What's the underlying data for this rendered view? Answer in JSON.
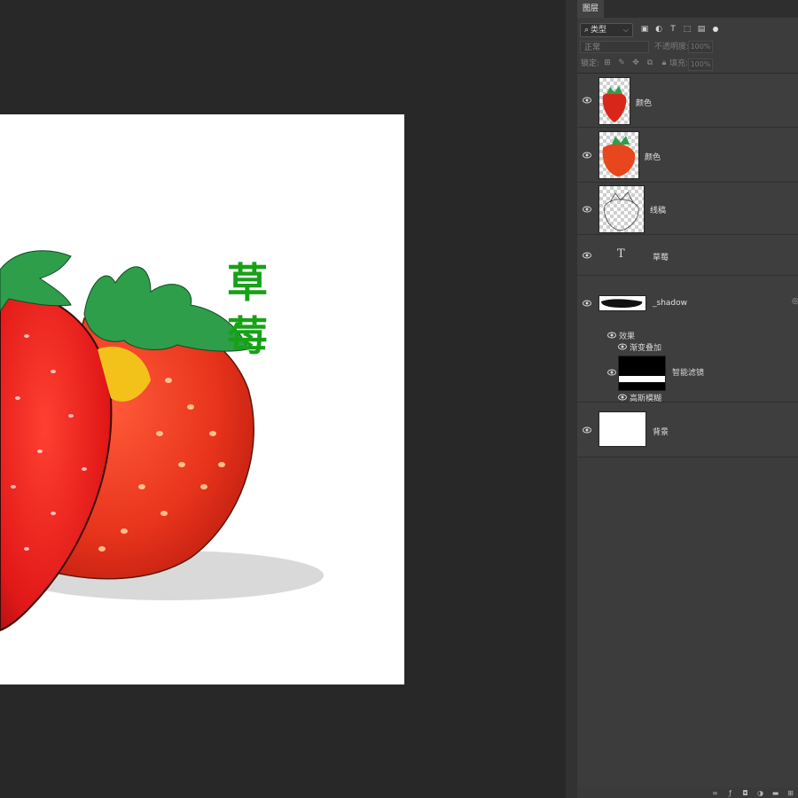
{
  "canvas": {
    "title": "草莓"
  },
  "panel": {
    "tab_label": "图层",
    "filter": {
      "icon": "search-icon",
      "value": "类型"
    },
    "blend_mode": "正常",
    "opacity_label": "不透明度:",
    "opacity_value": "100%",
    "lock_label": "锁定:",
    "fill_label": "填充:",
    "fill_value": "100%"
  },
  "layers": [
    {
      "name": "颜色"
    },
    {
      "name": "颜色"
    },
    {
      "name": "线稿"
    },
    {
      "name": "草莓",
      "type_glyph": "T"
    },
    {
      "name": "_shadow",
      "effects_label": "效果",
      "effect_item": "渐变叠加",
      "smart_filter_label": "智能滤镜",
      "filter_item": "高斯模糊"
    },
    {
      "name": "背景"
    }
  ],
  "colors": {
    "title_green": "#17a117",
    "panel_bg": "#3c3c3c",
    "workspace_bg": "#282828"
  }
}
